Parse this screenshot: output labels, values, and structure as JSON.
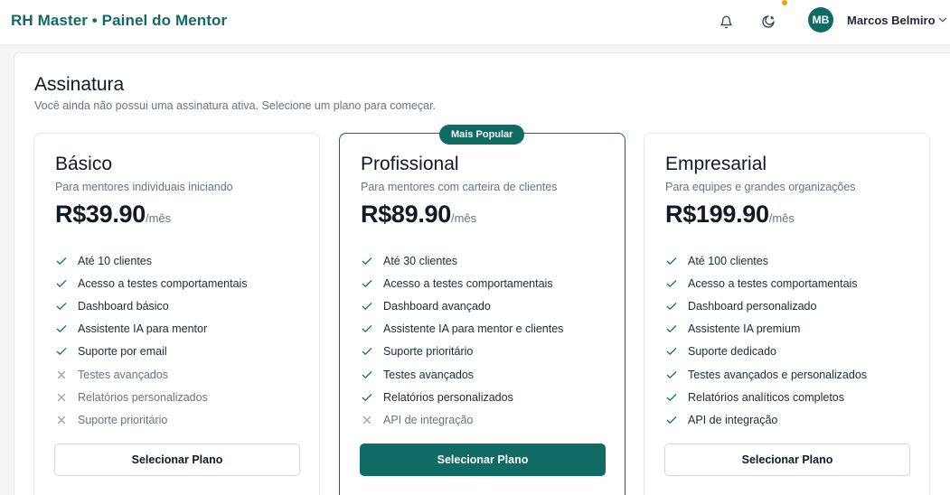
{
  "header": {
    "title": "RH Master • Painel do Mentor",
    "user_initials": "MB",
    "user_name": "Marcos Belmiro"
  },
  "page": {
    "title": "Assinatura",
    "subtitle": "Você ainda não possui uma assinatura ativa. Selecione um plano para começar."
  },
  "colors": {
    "brand": "#0f6b64",
    "notification_dot": "#f59e0b"
  },
  "plans": [
    {
      "name": "Básico",
      "description": "Para mentores individuais iniciando",
      "price": "R$39.90",
      "period": "/mês",
      "button": "Selecionar Plano",
      "features": [
        {
          "text": "Até 10 clientes",
          "included": true
        },
        {
          "text": "Acesso a testes comportamentais",
          "included": true
        },
        {
          "text": "Dashboard básico",
          "included": true
        },
        {
          "text": "Assistente IA para mentor",
          "included": true
        },
        {
          "text": "Suporte por email",
          "included": true
        },
        {
          "text": "Testes avançados",
          "included": false
        },
        {
          "text": "Relatórios personalizados",
          "included": false
        },
        {
          "text": "Suporte prioritário",
          "included": false
        }
      ]
    },
    {
      "name": "Profissional",
      "badge": "Mais Popular",
      "description": "Para mentores com carteira de clientes",
      "price": "R$89.90",
      "period": "/mês",
      "button": "Selecionar Plano",
      "features": [
        {
          "text": "Até 30 clientes",
          "included": true
        },
        {
          "text": "Acesso a testes comportamentais",
          "included": true
        },
        {
          "text": "Dashboard avançado",
          "included": true
        },
        {
          "text": "Assistente IA para mentor e clientes",
          "included": true
        },
        {
          "text": "Suporte prioritário",
          "included": true
        },
        {
          "text": "Testes avançados",
          "included": true
        },
        {
          "text": "Relatórios personalizados",
          "included": true
        },
        {
          "text": "API de integração",
          "included": false
        }
      ]
    },
    {
      "name": "Empresarial",
      "description": "Para equipes e grandes organizações",
      "price": "R$199.90",
      "period": "/mês",
      "button": "Selecionar Plano",
      "features": [
        {
          "text": "Até 100 clientes",
          "included": true
        },
        {
          "text": "Acesso a testes comportamentais",
          "included": true
        },
        {
          "text": "Dashboard personalizado",
          "included": true
        },
        {
          "text": "Assistente IA premium",
          "included": true
        },
        {
          "text": "Suporte dedicado",
          "included": true
        },
        {
          "text": "Testes avançados e personalizados",
          "included": true
        },
        {
          "text": "Relatórios analíticos completos",
          "included": true
        },
        {
          "text": "API de integração",
          "included": true
        }
      ]
    }
  ]
}
